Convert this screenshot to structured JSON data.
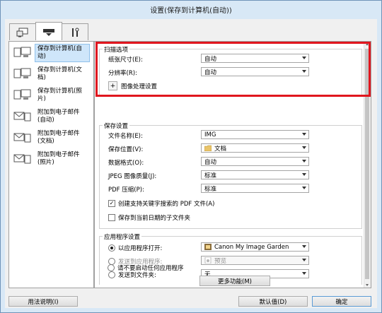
{
  "window": {
    "title": "设置(保存到计算机(自动))"
  },
  "tabs": [
    {
      "icon": "scan-computer-icon"
    },
    {
      "icon": "scanner-icon"
    },
    {
      "icon": "tools-icon"
    }
  ],
  "sidebar": {
    "items": [
      {
        "label": "保存到计算机(自动)"
      },
      {
        "label": "保存到计算机(文档)"
      },
      {
        "label": "保存到计算机(照片)"
      },
      {
        "label": "附加到电子邮件(自动)"
      },
      {
        "label": "附加到电子邮件(文档)"
      },
      {
        "label": "附加到电子邮件(照片)"
      }
    ]
  },
  "scan_options": {
    "title": "扫描选项",
    "paper_size_label": "纸张尺寸(E):",
    "paper_size_value": "自动",
    "resolution_label": "分辨率(R):",
    "resolution_value": "自动",
    "image_processing_label": "图像处理设置",
    "image_processing_toggle": "+"
  },
  "save_settings": {
    "title": "保存设置",
    "filename_label": "文件名称(E):",
    "filename_value": "IMG",
    "save_in_label": "保存位置(V):",
    "save_in_value": "文档",
    "data_format_label": "数据格式(O):",
    "data_format_value": "自动",
    "jpeg_quality_label": "JPEG 图像质量(J):",
    "jpeg_quality_value": "标准",
    "pdf_compression_label": "PDF 压缩(P):",
    "pdf_compression_value": "标准",
    "searchable_pdf_label": "创建支持关键字搜索的 PDF 文件(A)",
    "searchable_pdf_checked": true,
    "subfolder_label": "保存到当前日期的子文件夹",
    "subfolder_checked": false
  },
  "app_settings": {
    "title": "应用程序设置",
    "open_app_label": "以应用程序打开:",
    "open_app_value": "Canon My Image Garden",
    "send_app_label": "发送到应用程序:",
    "send_app_value": "预览",
    "send_folder_label": "发送到文件夹:",
    "send_folder_value": "无",
    "no_app_label": "请不要启动任何应用程序",
    "more_functions_label": "更多功能(M)",
    "selected": "open_app"
  },
  "footer": {
    "help_label": "用法说明(I)",
    "defaults_label": "默认值(D)",
    "ok_label": "确定"
  }
}
